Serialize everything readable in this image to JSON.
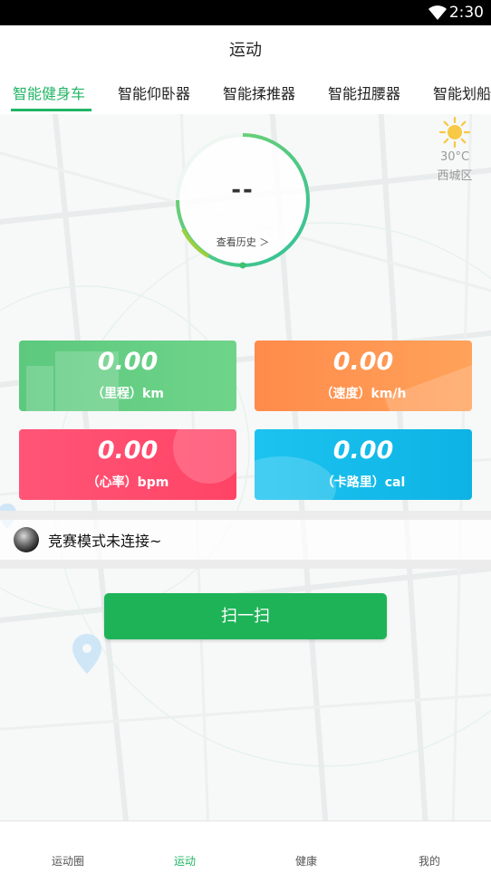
{
  "status_bar": {
    "time": "2:30"
  },
  "header": {
    "title": "运动"
  },
  "tabs": [
    {
      "label": "智能健身车",
      "active": true
    },
    {
      "label": "智能仰卧器",
      "active": false
    },
    {
      "label": "智能揉推器",
      "active": false
    },
    {
      "label": "智能扭腰器",
      "active": false
    },
    {
      "label": "智能划船",
      "active": false
    }
  ],
  "weather": {
    "icon": "sun-icon",
    "temperature": "30°C",
    "district": "西城区"
  },
  "ring": {
    "value": "--",
    "history_label": "查看历史 ＞"
  },
  "metrics": {
    "distance": {
      "value": "0.00",
      "label": "（里程）km"
    },
    "speed": {
      "value": "0.00",
      "label": "（速度）km/h"
    },
    "heart_rate": {
      "value": "0.00",
      "label": "（心率）bpm"
    },
    "calories": {
      "value": "0.00",
      "label": "（卡路里）cal"
    }
  },
  "race": {
    "status_text": "竞赛模式未连接~"
  },
  "scan_button": {
    "label": "扫一扫"
  },
  "bottom_nav": [
    {
      "label": "运动圈",
      "active": false
    },
    {
      "label": "运动",
      "active": true
    },
    {
      "label": "健康",
      "active": false
    },
    {
      "label": "我的",
      "active": false
    }
  ],
  "colors": {
    "accent": "#22b565",
    "distance_card": "#5cc97e",
    "speed_card": "#ff8b4b",
    "heart_card": "#ff4d6d",
    "calories_card": "#14bde9"
  }
}
